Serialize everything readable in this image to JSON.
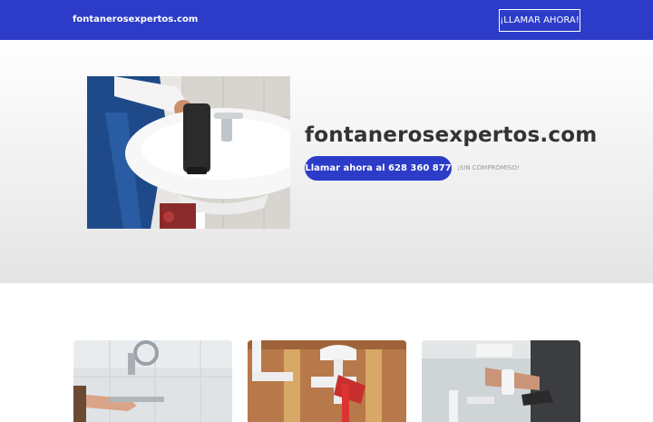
{
  "navbar": {
    "brand": "fontanerosexpertos.com",
    "cta_label": "¡LLAMAR AHORA!"
  },
  "hero": {
    "title": "fontanerosexpertos.com",
    "call_label": "Llamar ahora al 628 360 877",
    "note": "¡SIN COMPROMISO!"
  },
  "colors": {
    "brand_blue": "#2c3cc8",
    "hero_gradient_top": "#ffffff",
    "hero_gradient_bottom": "#e4e4e4",
    "title_text": "#333333"
  }
}
